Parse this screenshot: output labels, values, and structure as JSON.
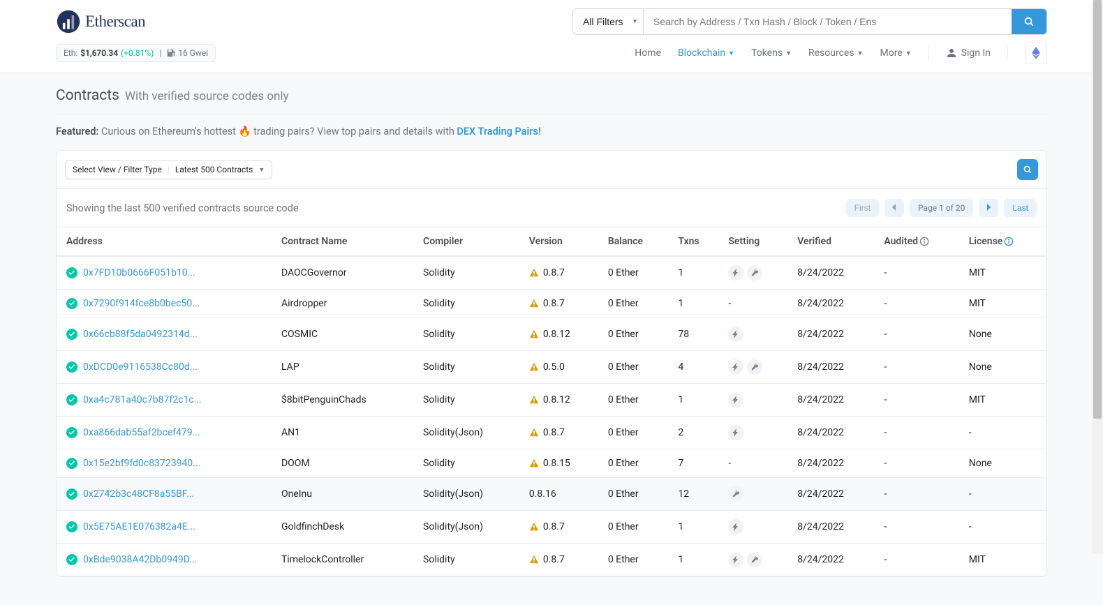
{
  "brand": "Etherscan",
  "status": {
    "price_label": "Eth:",
    "price": "$1,670.34",
    "change": "(+0.81%)",
    "gas": "16 Gwei"
  },
  "search": {
    "filter_label": "All Filters",
    "placeholder": "Search by Address / Txn Hash / Block / Token / Ens"
  },
  "nav": {
    "home": "Home",
    "blockchain": "Blockchain",
    "tokens": "Tokens",
    "resources": "Resources",
    "more": "More",
    "signin": "Sign In"
  },
  "page": {
    "title": "Contracts",
    "subtitle": "With verified source codes only"
  },
  "featured": {
    "label": "Featured:",
    "text_before": " Curious on Ethereum's hottest ",
    "emoji": "🔥",
    "text_after": " trading pairs? View top pairs and details with ",
    "link": "DEX Trading Pairs!"
  },
  "viewSelect": {
    "left": "Select View / Filter Type",
    "right": "Latest 500 Contracts"
  },
  "showing": "Showing the last 500 verified contracts source code",
  "pager": {
    "first": "First",
    "info": "Page 1 of 20",
    "last": "Last"
  },
  "columns": {
    "address": "Address",
    "name": "Contract Name",
    "compiler": "Compiler",
    "version": "Version",
    "balance": "Balance",
    "txns": "Txns",
    "setting": "Setting",
    "verified": "Verified",
    "audited": "Audited",
    "license": "License"
  },
  "rows": [
    {
      "address": "0x7FD10b0666F051b10...",
      "name": "DAOCGovernor",
      "compiler": "Solidity",
      "version": "0.8.7",
      "warn": true,
      "balance": "0 Ether",
      "txns": "1",
      "setting": [
        "bolt",
        "wrench"
      ],
      "verified": "8/24/2022",
      "audited": "-",
      "license": "MIT",
      "hl": false
    },
    {
      "address": "0x7290f914fce8b0bec50...",
      "name": "Airdropper",
      "compiler": "Solidity",
      "version": "0.8.7",
      "warn": true,
      "balance": "0 Ether",
      "txns": "1",
      "setting": [],
      "settingText": "-",
      "verified": "8/24/2022",
      "audited": "-",
      "license": "MIT",
      "hl": false
    },
    {
      "address": "0x66cb88f5da0492314d...",
      "name": "COSMIC",
      "compiler": "Solidity",
      "version": "0.8.12",
      "warn": true,
      "balance": "0 Ether",
      "txns": "78",
      "setting": [
        "bolt"
      ],
      "verified": "8/24/2022",
      "audited": "-",
      "license": "None",
      "hl": false
    },
    {
      "address": "0xDCD0e9116538Cc80d...",
      "name": "LAP",
      "compiler": "Solidity",
      "version": "0.5.0",
      "warn": true,
      "balance": "0 Ether",
      "txns": "4",
      "setting": [
        "bolt",
        "wrench"
      ],
      "verified": "8/24/2022",
      "audited": "-",
      "license": "None",
      "hl": false
    },
    {
      "address": "0xa4c781a40c7b87f2c1c...",
      "name": "$8bitPenguinChads",
      "compiler": "Solidity",
      "version": "0.8.12",
      "warn": true,
      "balance": "0 Ether",
      "txns": "1",
      "setting": [
        "bolt"
      ],
      "verified": "8/24/2022",
      "audited": "-",
      "license": "MIT",
      "hl": false
    },
    {
      "address": "0xa866dab55af2bcef479...",
      "name": "AN1",
      "compiler": "Solidity(Json)",
      "version": "0.8.7",
      "warn": true,
      "balance": "0 Ether",
      "txns": "2",
      "setting": [
        "bolt"
      ],
      "verified": "8/24/2022",
      "audited": "-",
      "license": "-",
      "hl": false
    },
    {
      "address": "0x15e2bf9fd0c83723940...",
      "name": "DOOM",
      "compiler": "Solidity",
      "version": "0.8.15",
      "warn": true,
      "balance": "0 Ether",
      "txns": "7",
      "setting": [],
      "settingText": "-",
      "verified": "8/24/2022",
      "audited": "-",
      "license": "None",
      "hl": false
    },
    {
      "address": "0x2742b3c48CF8a55BF...",
      "name": "OneInu",
      "compiler": "Solidity(Json)",
      "version": "0.8.16",
      "warn": false,
      "balance": "0 Ether",
      "txns": "12",
      "setting": [
        "wrench"
      ],
      "verified": "8/24/2022",
      "audited": "-",
      "license": "-",
      "hl": true
    },
    {
      "address": "0x5E75AE1E076382a4E...",
      "name": "GoldfinchDesk",
      "compiler": "Solidity(Json)",
      "version": "0.8.7",
      "warn": true,
      "balance": "0 Ether",
      "txns": "1",
      "setting": [
        "bolt"
      ],
      "verified": "8/24/2022",
      "audited": "-",
      "license": "-",
      "hl": false
    },
    {
      "address": "0xBde9038A42Db0949D...",
      "name": "TimelockController",
      "compiler": "Solidity",
      "version": "0.8.7",
      "warn": true,
      "balance": "0 Ether",
      "txns": "1",
      "setting": [
        "bolt",
        "wrench"
      ],
      "verified": "8/24/2022",
      "audited": "-",
      "license": "MIT",
      "hl": false
    }
  ]
}
